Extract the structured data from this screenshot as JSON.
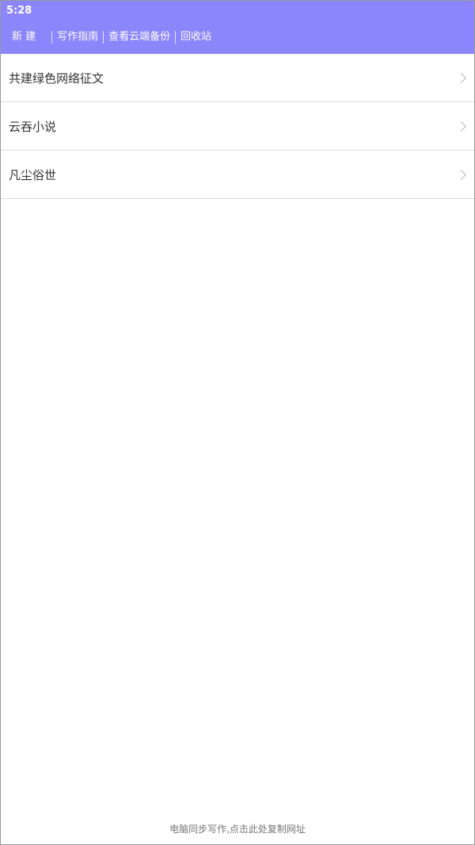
{
  "status_bar": {
    "time": "5:28"
  },
  "toolbar": {
    "items": [
      {
        "label": "新 建"
      },
      {
        "label": "写作指南"
      },
      {
        "label": "查看云端备份"
      },
      {
        "label": "回收站"
      }
    ]
  },
  "book_list": {
    "items": [
      {
        "title": "共建绿色网络征文"
      },
      {
        "title": "云吞小说"
      },
      {
        "title": "凡尘俗世"
      }
    ]
  },
  "footer": {
    "sync_text": "电脑同步写作,点击此处复制网址"
  },
  "colors": {
    "accent": "#8b86fb",
    "divider": "#dcdcdc"
  }
}
